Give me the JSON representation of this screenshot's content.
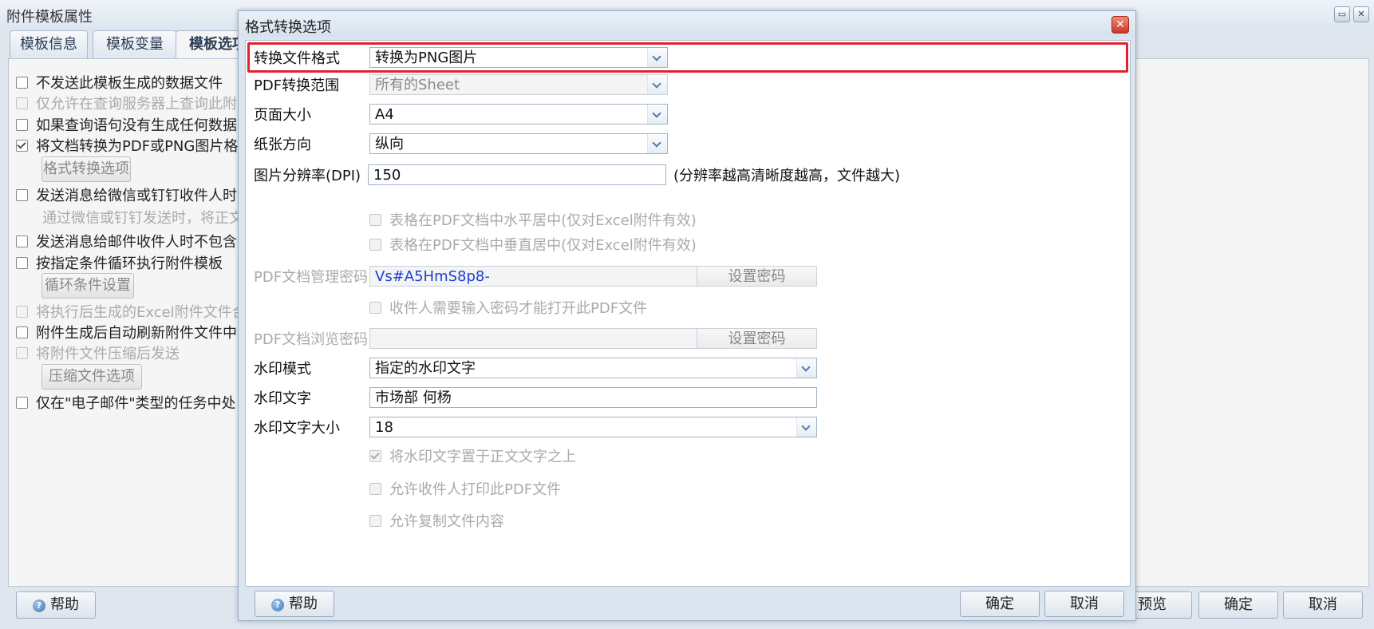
{
  "background": {
    "title": "附件模板属性",
    "tabs": [
      "模板信息",
      "模板变量",
      "模板选项"
    ],
    "options": [
      {
        "label": "不发送此模板生成的数据文件",
        "checked": false,
        "disabled": false
      },
      {
        "label": "仅允许在查询服务器上查询此附",
        "checked": false,
        "disabled": true
      },
      {
        "label": "如果查询语句没有生成任何数据",
        "checked": false,
        "disabled": false
      },
      {
        "label": "将文档转换为PDF或PNG图片格",
        "checked": true,
        "disabled": false
      },
      {
        "label": "发送消息给微信或钉钉收件人时",
        "checked": false,
        "disabled": false
      },
      {
        "label": "通过微信或钉钉发送时，将正文",
        "checked": false,
        "disabled": true
      },
      {
        "label": "发送消息给邮件收件人时不包含",
        "checked": false,
        "disabled": false
      },
      {
        "label": "按指定条件循环执行附件模板",
        "checked": false,
        "disabled": false
      },
      {
        "label": "将执行后生成的Excel附件文件合",
        "checked": false,
        "disabled": true
      },
      {
        "label": "附件生成后自动刷新附件文件中",
        "checked": false,
        "disabled": false
      },
      {
        "label": "将附件文件压缩后发送",
        "checked": false,
        "disabled": true
      },
      {
        "label": "仅在\"电子邮件\"类型的任务中处",
        "checked": false,
        "disabled": false
      }
    ],
    "buttons": {
      "format_options": "格式转换选项",
      "loop_settings": "循环条件设置",
      "compress_options": "压缩文件选项"
    },
    "footer": {
      "help": "帮助",
      "preview": "预览",
      "ok": "确定",
      "cancel": "取消"
    }
  },
  "dialog": {
    "title": "格式转换选项",
    "fields": {
      "convert_format": {
        "label": "转换文件格式",
        "value": "转换为PNG图片"
      },
      "pdf_range": {
        "label": "PDF转换范围",
        "value": "所有的Sheet"
      },
      "page_size": {
        "label": "页面大小",
        "value": "A4"
      },
      "orientation": {
        "label": "纸张方向",
        "value": "纵向"
      },
      "dpi": {
        "label": "图片分辨率(DPI)",
        "value": "150",
        "hint": "(分辨率越高清晰度越高，文件越大)"
      },
      "center_h": {
        "label": "表格在PDF文档中水平居中(仅对Excel附件有效)",
        "checked": false
      },
      "center_v": {
        "label": "表格在PDF文档中垂直居中(仅对Excel附件有效)",
        "checked": false
      },
      "admin_pwd": {
        "label": "PDF文档管理密码",
        "value": "Vs#A5HmS8p8-",
        "button": "设置密码"
      },
      "require_pwd": {
        "label": "收件人需要输入密码才能打开此PDF文件",
        "checked": false
      },
      "view_pwd": {
        "label": "PDF文档浏览密码",
        "value": "",
        "button": "设置密码"
      },
      "watermark_mode": {
        "label": "水印模式",
        "value": "指定的水印文字"
      },
      "watermark_text": {
        "label": "水印文字",
        "value": "市场部 何杨"
      },
      "watermark_size": {
        "label": "水印文字大小",
        "value": "18"
      },
      "watermark_on_top": {
        "label": "将水印文字置于正文文字之上",
        "checked": true
      },
      "allow_print": {
        "label": "允许收件人打印此PDF文件",
        "checked": false
      },
      "allow_copy": {
        "label": "允许复制文件内容",
        "checked": false
      }
    },
    "footer": {
      "help": "帮助",
      "ok": "确定",
      "cancel": "取消"
    }
  },
  "colors": {
    "highlight": "#e0222f",
    "password_text": "#1c3fd0"
  },
  "icons": {
    "help": "help-icon",
    "close": "close-icon",
    "dropdown": "chevron-down-icon",
    "restore": "restore-icon"
  }
}
